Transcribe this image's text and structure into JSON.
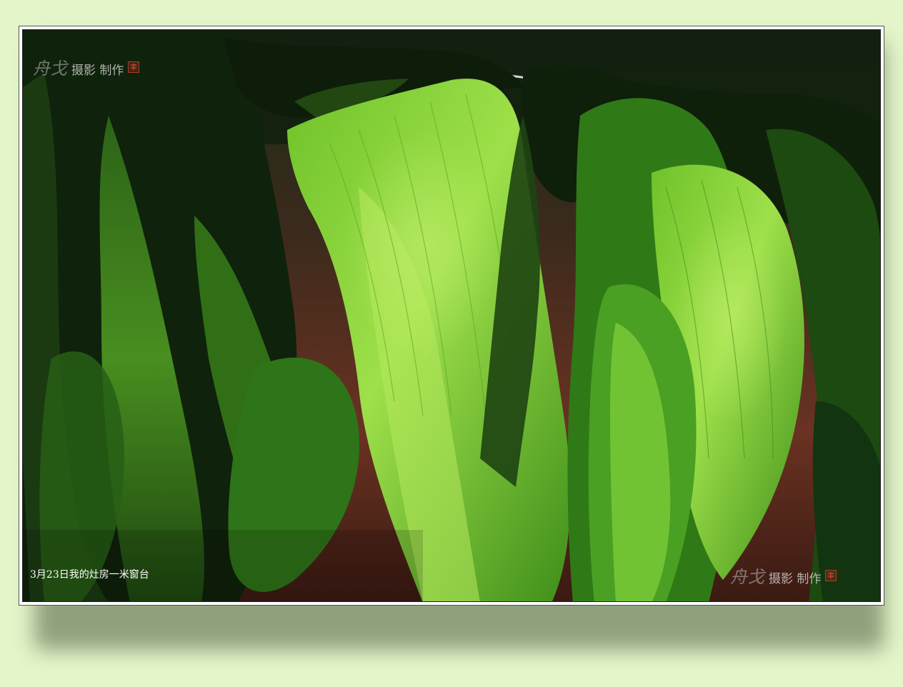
{
  "photo": {
    "caption": "3月23日我的灶房一米窗台",
    "subject": "mustard-greens-drying-on-line"
  },
  "watermark": {
    "signature": "舟戈",
    "text": "摄影 制作",
    "seal_icon": "red-seal-icon"
  },
  "colors": {
    "page_background": "#e3f5c9",
    "frame": "#ffffff",
    "leaf_bright": "#8fd23a",
    "leaf_dark": "#1c3a12",
    "background_brick": "#7a3a26"
  }
}
